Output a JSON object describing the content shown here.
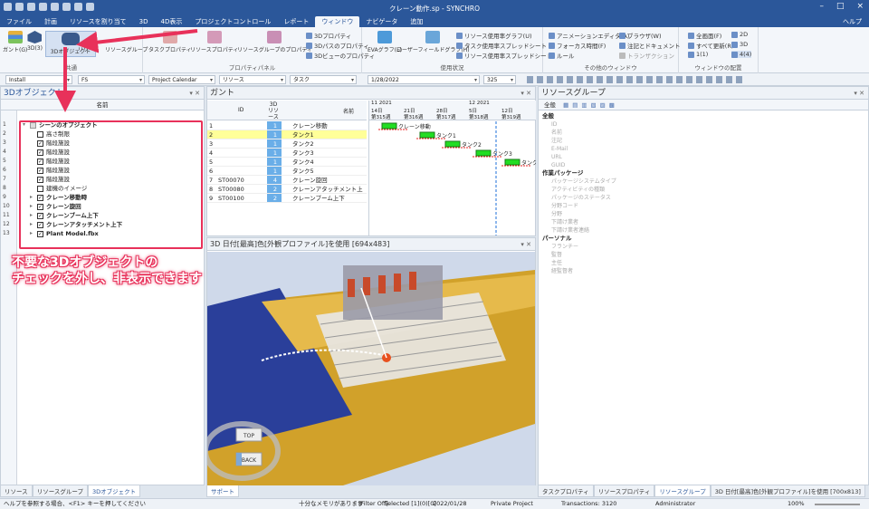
{
  "window": {
    "title": "クレーン動作.sp - SYNCHRO",
    "help": "ヘルプ"
  },
  "menu": [
    "ファイル",
    "計画",
    "リソースを割り当て",
    "3D",
    "4D表示",
    "プロジェクトコントロール",
    "レポート",
    "ウィンドウ",
    "ナビゲータ",
    "追加"
  ],
  "menu_active_index": 7,
  "ribbon": {
    "group_common": {
      "label": "共通",
      "buttons": [
        "ガント(G)",
        "3D(3)",
        "3Dオブジェクト",
        "リソース",
        "リソースグループ"
      ]
    },
    "group_property": {
      "label": "プロパティパネル",
      "buttons": [
        "タスクプロパティ",
        "リソースプロパティ",
        "リソースグループのプロパティ"
      ],
      "small": [
        "3Dプロパティ",
        "3Dパスのプロパティ",
        "3Dビューのプロパティ"
      ]
    },
    "group_usage": {
      "label": "使用状況",
      "buttons": [
        "EVAグラフ(E)",
        "ユーザーフィールドグラフ(H)"
      ],
      "small": [
        "リソース使用率グラフ(U)",
        "タスク使用率スプレッドシート",
        "リソース使用率スプレッドシート"
      ]
    },
    "group_other": {
      "label": "その他のウィンドウ",
      "small": [
        "アニメーションエディタ(A)",
        "フォーカス時間(F)",
        "ルール",
        "ブラウザ(W)",
        "注記とドキュメント",
        "トランザクション"
      ]
    },
    "group_layout": {
      "label": "ウィンドウの配置",
      "small": [
        "全画面(F)",
        "すべて更新(R)",
        "1(1)",
        "2D",
        "3D",
        "4(4)"
      ]
    }
  },
  "toolbar": {
    "combo1": "Install",
    "combo2": "FS",
    "combo3": "Project Calendar",
    "combo4": "リソース",
    "combo5": "タスク",
    "date": "1/28/2022",
    "num": "325"
  },
  "obj_panel": {
    "title": "3Dオブジェクト",
    "col_name": "名前",
    "rows": [
      {
        "num": "1",
        "label": "シーンのオブジェクト",
        "level": 0,
        "check": "partial",
        "bold": true,
        "exp": "▾"
      },
      {
        "num": "2",
        "label": "高さ制限",
        "level": 1,
        "check": "off"
      },
      {
        "num": "3",
        "label": "階段施設",
        "level": 1,
        "check": "on"
      },
      {
        "num": "4",
        "label": "階段施設",
        "level": 1,
        "check": "on"
      },
      {
        "num": "5",
        "label": "階段施設",
        "level": 1,
        "check": "on"
      },
      {
        "num": "6",
        "label": "階段施設",
        "level": 1,
        "check": "on"
      },
      {
        "num": "7",
        "label": "階段施設",
        "level": 1,
        "check": "on"
      },
      {
        "num": "8",
        "label": "建機のイメージ",
        "level": 1,
        "check": "off"
      },
      {
        "num": "9",
        "label": "クレーン移動時",
        "level": 1,
        "check": "on",
        "bold": true,
        "exp": "▸"
      },
      {
        "num": "10",
        "label": "クレーン旋回",
        "level": 1,
        "check": "on",
        "bold": true,
        "exp": "▸"
      },
      {
        "num": "11",
        "label": "クレーンブーム上下",
        "level": 1,
        "check": "on",
        "bold": true,
        "exp": "▸"
      },
      {
        "num": "12",
        "label": "クレーンアタッチメント上下",
        "level": 1,
        "check": "on",
        "bold": true,
        "exp": "▸"
      },
      {
        "num": "13",
        "label": "Plant Model.fbx",
        "level": 1,
        "check": "on",
        "bold": true,
        "exp": "▸"
      }
    ],
    "callout_line1": "不要な3Dオブジェクトの",
    "callout_line2": "チェックを外し、非表示できます",
    "tabs": [
      "リソース",
      "リソースグループ",
      "3Dオブジェクト"
    ]
  },
  "gantt": {
    "title": "ガント",
    "col_id": "ID",
    "col_3d": "3Dリソース",
    "col_name": "名前",
    "rows": [
      {
        "n": "1",
        "id": "",
        "res": "1",
        "name": "クレーン移動"
      },
      {
        "n": "2",
        "id": "",
        "res": "1",
        "name": "タンク1",
        "hl": true
      },
      {
        "n": "3",
        "id": "",
        "res": "1",
        "name": "タンク2"
      },
      {
        "n": "4",
        "id": "",
        "res": "1",
        "name": "タンク3"
      },
      {
        "n": "5",
        "id": "",
        "res": "1",
        "name": "タンク4"
      },
      {
        "n": "6",
        "id": "",
        "res": "1",
        "name": "タンク5"
      },
      {
        "n": "7",
        "id": "ST00070",
        "res": "4",
        "name": "クレーン旋回"
      },
      {
        "n": "8",
        "id": "ST00080",
        "res": "2",
        "name": "クレーンアタッチメント上"
      },
      {
        "n": "9",
        "id": "ST00100",
        "res": "2",
        "name": "クレーンブーム上下"
      }
    ],
    "month1": "11 2021",
    "month2": "12 2021",
    "days": [
      "14日",
      "21日",
      "28日",
      "5日",
      "12日"
    ],
    "weeks": [
      "第315週",
      "第316週",
      "第317週",
      "第318週",
      "第319週"
    ],
    "bar_labels": [
      "クレーン移動",
      "タンク1",
      "タンク2",
      "タンク3",
      "タンク"
    ]
  },
  "view3d": {
    "title": "3D 日付[最高]色[外観プロファイル]を使用 [694x483]",
    "nav_top": "TOP",
    "nav_back": "BACK",
    "tabs": [
      "サポート"
    ]
  },
  "resgroup": {
    "title": "リソースグループ",
    "toolbar_all": "全般",
    "categories": [
      {
        "name": "全般",
        "items": [
          "ID",
          "名前",
          "注記",
          "E-Mail",
          "URL",
          "GUID"
        ]
      },
      {
        "name": "作業パッケージ",
        "items": [
          "パッケージシステムタイプ",
          "アクティビティの種類",
          "パッケージのステータス",
          "分野コード",
          "分野",
          "下請け業者",
          "下請け業者連絡"
        ]
      },
      {
        "name": "パーソナル",
        "items": [
          "フランチー",
          "監督",
          "主任",
          "経監督者"
        ]
      }
    ],
    "tabs": [
      "タスクプロパティ",
      "リソースプロパティ",
      "リソースグループ",
      "3D 日付[最高]色[外観プロファイル]を使用 [700x813]"
    ]
  },
  "status": {
    "help": "ヘルプを参照する場合、<F1> キーを押してください",
    "memory": "十分なメモリがあります",
    "filter": "[Filter Off]",
    "selected": "Selected [1](0)[0]",
    "date": "2022/01/28",
    "project": "Private Project",
    "transactions": "Transactions: 3120",
    "user": "Administrator",
    "zoom": "100%"
  },
  "colors": {
    "accent": "#2b579a",
    "callout": "#e8315a",
    "floor": "#d1a12a",
    "sky": "#cfd9ea",
    "gantt_bar": "#22dd22",
    "highlight_row": "#ffff99"
  }
}
